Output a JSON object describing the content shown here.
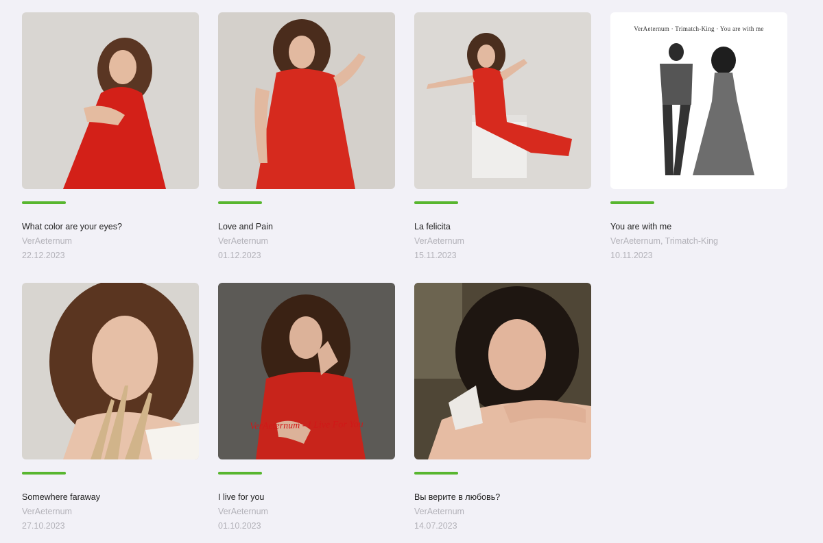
{
  "accent_color": "#58b62f",
  "releases": [
    {
      "title": "What color are your eyes?",
      "artist": "VerAeternum",
      "date": "22.12.2023",
      "cover_icon": "woman-red-dress-photo"
    },
    {
      "title": "Love and Pain",
      "artist": "VerAeternum",
      "date": "01.12.2023",
      "cover_icon": "woman-red-dress-dancing-photo"
    },
    {
      "title": "La felicita",
      "artist": "VerAeternum",
      "date": "15.11.2023",
      "cover_icon": "woman-seated-on-cube-photo"
    },
    {
      "title": "You are with me",
      "artist": "VerAeternum, Trimatch-King",
      "date": "10.11.2023",
      "cover_icon": "couple-bw-photo",
      "cover_text": "VerAeternum · Trimatch-King · You are with me"
    },
    {
      "title": "Somewhere faraway",
      "artist": "VerAeternum",
      "date": "27.10.2023",
      "cover_icon": "woman-portrait-grass-photo"
    },
    {
      "title": "I live for you",
      "artist": "VerAeternum",
      "date": "01.10.2023",
      "cover_icon": "woman-seated-dark-photo",
      "cover_text": "VerAeternum - I Live For You"
    },
    {
      "title": "Вы верите в любовь?",
      "artist": "VerAeternum",
      "date": "14.07.2023",
      "cover_icon": "woman-portrait-closeup-photo"
    }
  ]
}
